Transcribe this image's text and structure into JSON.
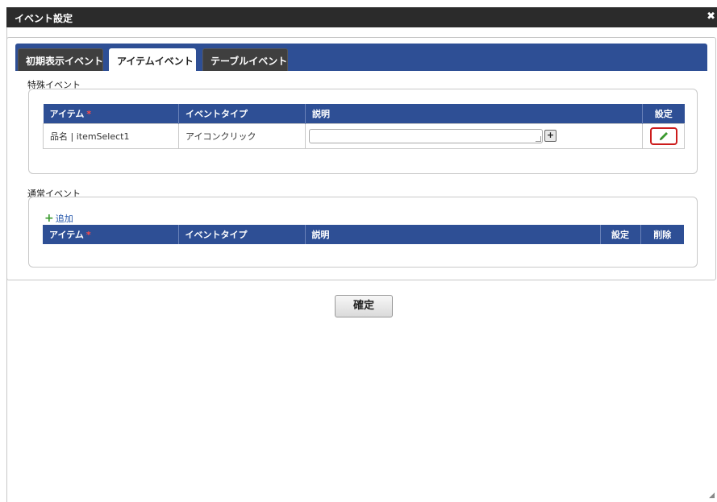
{
  "window": {
    "title": "イベント設定",
    "close_icon": "✖"
  },
  "tabs": [
    {
      "label": "初期表示イベント",
      "active": false
    },
    {
      "label": "アイテムイベント",
      "active": true
    },
    {
      "label": "テーブルイベント",
      "active": false
    }
  ],
  "special_events": {
    "section_label": "特殊イベント",
    "columns": {
      "item": "アイテム",
      "required_mark": "*",
      "event_type": "イベントタイプ",
      "description": "説明",
      "settings": "設定"
    },
    "rows": [
      {
        "item": "品名 | itemSelect1",
        "event_type": "アイコンクリック",
        "description": ""
      }
    ],
    "add_description_icon": "+",
    "edit_icon": "pencil-icon"
  },
  "normal_events": {
    "section_label": "通常イベント",
    "add_label": "追加",
    "add_icon": "+",
    "columns": {
      "item": "アイテム",
      "required_mark": "*",
      "event_type": "イベントタイプ",
      "description": "説明",
      "settings": "設定",
      "delete": "削除"
    }
  },
  "confirm_button": "確定",
  "colors": {
    "header_blue": "#2e4f95",
    "titlebar": "#2b2b2b",
    "highlight_red": "#cc1c1c",
    "add_green": "#3a9a2e"
  }
}
